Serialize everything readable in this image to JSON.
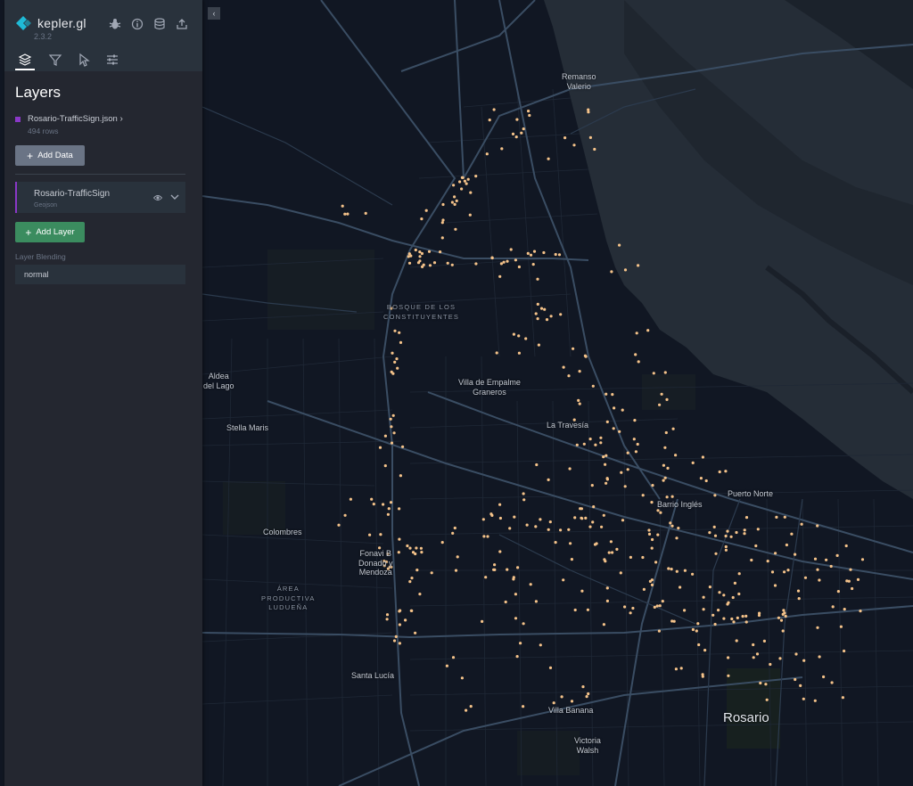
{
  "app": {
    "name": "kepler.gl",
    "version": "2.3.2"
  },
  "header_icons": [
    "bug-icon",
    "info-icon",
    "database-icon",
    "share-icon"
  ],
  "tabs": [
    "layers-icon",
    "filter-icon",
    "interaction-icon",
    "settings-icon"
  ],
  "panel": {
    "title": "Layers"
  },
  "dataset": {
    "name": "Rosario-TrafficSign.json",
    "rows": "494 rows",
    "color": "#8a38c7"
  },
  "buttons": {
    "add_data": "Add Data",
    "add_layer": "Add Layer"
  },
  "layer": {
    "name": "Rosario-TrafficSign",
    "type": "Geojson"
  },
  "blending": {
    "label": "Layer Blending",
    "value": "normal"
  },
  "map": {
    "point_color": "#f5c38a",
    "labels": {
      "remanso": "Remanso\nValerio",
      "bosque": "BOSQUE DE LOS\nCONSTITUYENTES",
      "aldea": "Aldea\ndel Lago",
      "villa_empalme": "Villa de Empalme\nGraneros",
      "stella": "Stella Maris",
      "travesia": "La Travesía",
      "puerto": "Puerto Norte",
      "ingles": "Barrio Inglés",
      "colombres": "Colombres",
      "fonavi": "Fonavi B\nDonado y\nMendoza",
      "area": "ÁREA\nPRODUCTIVA\nLUDUEÑA",
      "rosario": "Rosario",
      "santa_lucia": "Santa Lucía",
      "villa_banana": "Villa Banana",
      "victoria": "Victoria\nWalsh"
    }
  }
}
